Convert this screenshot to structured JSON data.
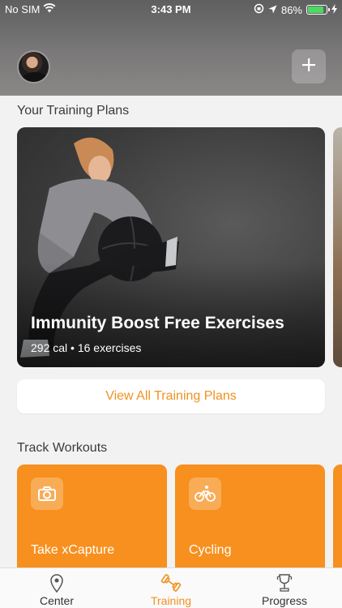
{
  "status_bar": {
    "carrier": "No SIM",
    "time": "3:43 PM",
    "battery_percent": "86%",
    "battery_level": 0.86
  },
  "header": {
    "avatar": "user-avatar",
    "add_icon": "plus-icon"
  },
  "training_plans": {
    "section_title": "Your Training Plans",
    "featured": {
      "title": "Immunity Boost Free Exercises",
      "calories": "292 cal",
      "separator": "•",
      "exercises": "16 exercises"
    },
    "view_all_label": "View All Training Plans"
  },
  "track_workouts": {
    "section_title": "Track Workouts",
    "items": [
      {
        "label": "Take xCapture",
        "icon": "camera-icon"
      },
      {
        "label": "Cycling",
        "icon": "bicycle-icon"
      }
    ]
  },
  "tab_bar": {
    "tabs": [
      {
        "label": "Center",
        "icon": "location-pin-icon"
      },
      {
        "label": "Training",
        "icon": "dumbbell-icon",
        "active": true
      },
      {
        "label": "Progress",
        "icon": "trophy-icon"
      }
    ]
  },
  "colors": {
    "accent": "#F0911F",
    "card_orange": "#F7901E",
    "battery_green": "#4CD964"
  }
}
